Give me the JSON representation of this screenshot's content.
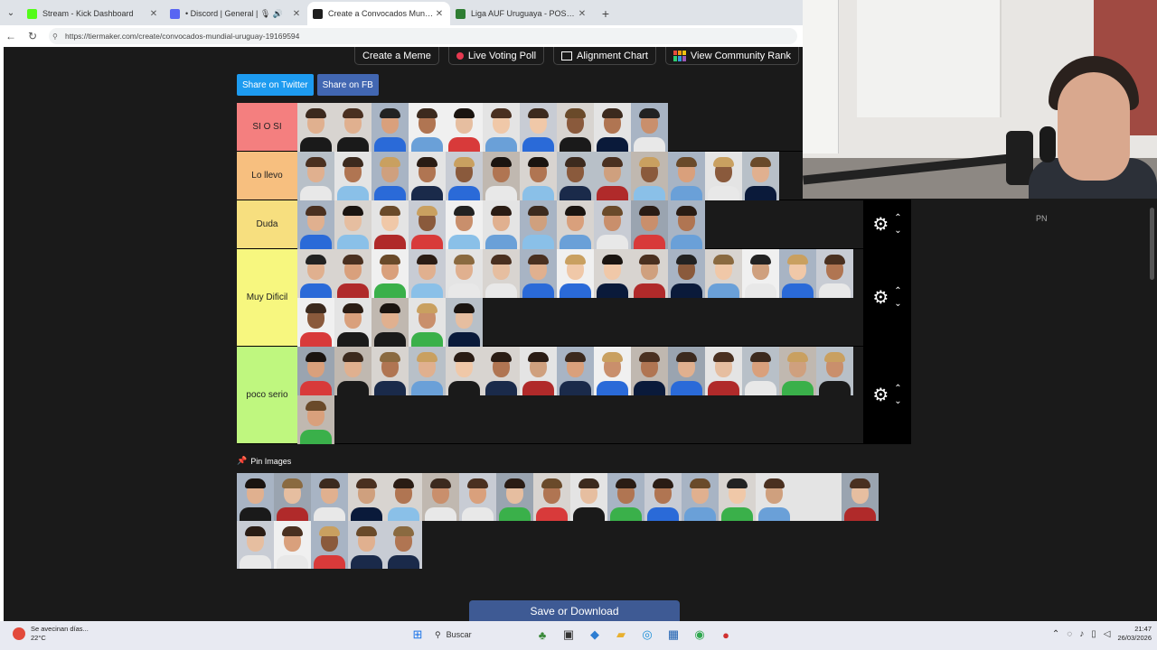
{
  "browser": {
    "tabs": [
      {
        "title": "Stream - Kick Dashboard",
        "color": "#53fc18",
        "active": false
      },
      {
        "title": "• Discord | General | 🎙 🔊",
        "color": "#5865f2",
        "active": false
      },
      {
        "title": "Create a Convocados Mundial Uru",
        "color": "#1f1f1f",
        "active": true
      },
      {
        "title": "Liga AUF Uruguaya - POSICIONES",
        "color": "#2e7d32",
        "active": false
      }
    ],
    "new_tab": "+",
    "url": "https://tiermaker.com/create/convocados-mundial-uruguay-19169594"
  },
  "toolbar": {
    "create_meme": "Create a Meme",
    "live_voting": "Live Voting Poll",
    "alignment_chart": "Alignment Chart",
    "community_rank": "View Community Rank"
  },
  "share": {
    "twitter": "Share on Twitter",
    "twitter_color": "#1d9bf0",
    "fb": "Share on FB",
    "fb_color": "#4267b2"
  },
  "tiers": [
    {
      "label": "SI O SI",
      "color": "#f47f7f",
      "count": 10
    },
    {
      "label": "Lo llevo",
      "color": "#f7bf7f",
      "count": 13
    },
    {
      "label": "Duda",
      "color": "#f7df7f",
      "count": 11
    },
    {
      "label": "Muy Dificil",
      "color": "#f7f77f",
      "count": 20
    },
    {
      "label": "poco serio",
      "color": "#bff77f",
      "count": 16
    }
  ],
  "pin_images": "Pin Images",
  "pool_count": 21,
  "save": "Save or Download",
  "side_label": "PN",
  "taskbar": {
    "weather_line1": "Se avecinan días...",
    "weather_line2": "22°C",
    "search": "Buscar",
    "time": "21:47",
    "date": "26/03/2026"
  }
}
